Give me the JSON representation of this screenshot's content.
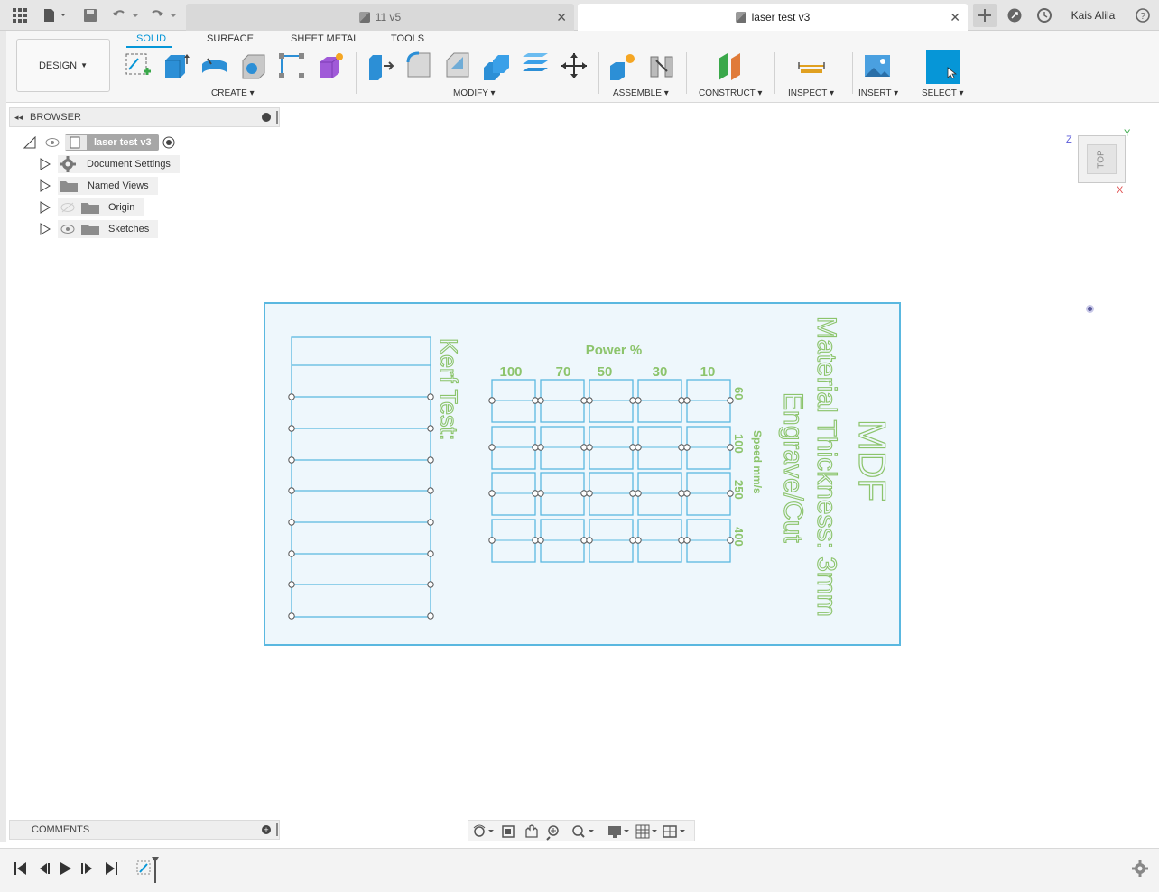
{
  "titlebar": {
    "inactive_tab": "11 v5",
    "active_tab": "laser test v3",
    "user": "Kais Alila"
  },
  "toolbar": {
    "workspace_button": "DESIGN",
    "workspace_tabs": [
      "SOLID",
      "SURFACE",
      "SHEET METAL",
      "TOOLS"
    ],
    "active_workspace": "SOLID",
    "groups": {
      "create": "CREATE",
      "modify": "MODIFY",
      "assemble": "ASSEMBLE",
      "construct": "CONSTRUCT",
      "inspect": "INSPECT",
      "insert": "INSERT",
      "select": "SELECT"
    }
  },
  "browser": {
    "title": "BROWSER",
    "root": "laser test v3",
    "items": [
      {
        "label": "Document Settings",
        "icon": "gear-icon"
      },
      {
        "label": "Named Views",
        "icon": "folder-icon"
      },
      {
        "label": "Origin",
        "icon": "folder-icon"
      },
      {
        "label": "Sketches",
        "icon": "folder-icon"
      }
    ]
  },
  "comments": {
    "title": "COMMENTS"
  },
  "viewcube": {
    "face": "TOP",
    "axis_z": "Z",
    "axis_y": "Y",
    "axis_x": "X"
  },
  "sketch": {
    "title": "MDF",
    "thickness": "Material Thickness: 3mm",
    "subtitle": "Engrave/Cut",
    "kerf": "Kerf Test:",
    "power_label": "Power %",
    "power_values": [
      "100",
      "70",
      "50",
      "30",
      "10"
    ],
    "speed_label": "Speed mm/s",
    "speed_values": [
      "60",
      "100",
      "250",
      "400"
    ]
  },
  "colors": {
    "accent": "#0696d7",
    "sketch_line": "#5ab8e0",
    "sketch_text": "#8cc46c",
    "sheet_fill": "#eef7fc"
  }
}
